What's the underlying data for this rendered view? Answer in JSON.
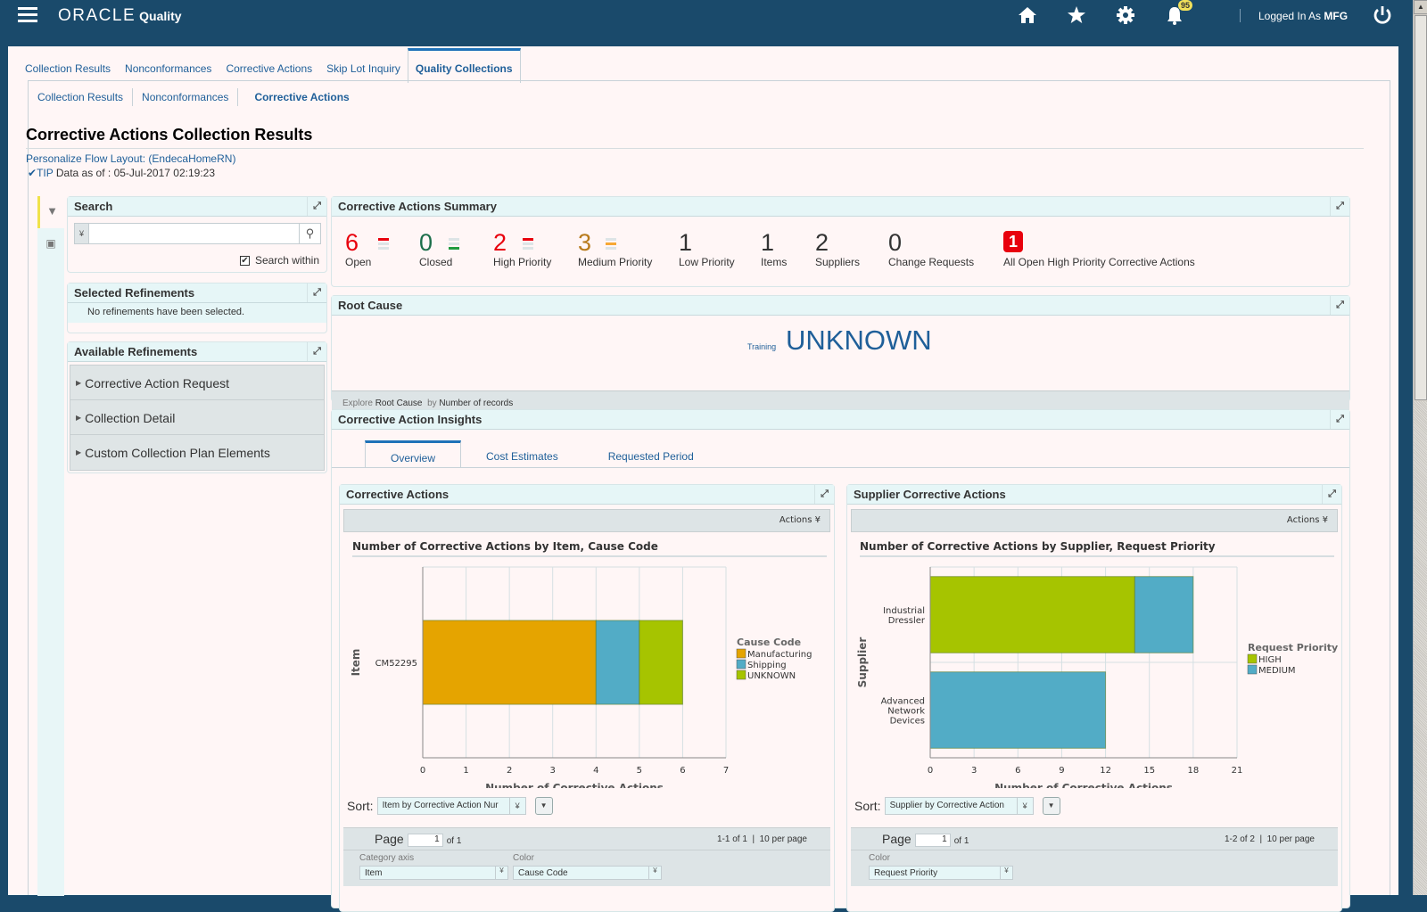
{
  "header": {
    "logo": "ORACLE",
    "app_name": "Quality",
    "notification_count": "95",
    "logged_in_prefix": "Logged In As",
    "user": "MFG"
  },
  "tabs": [
    {
      "label": "Collection Results"
    },
    {
      "label": "Nonconformances"
    },
    {
      "label": "Corrective Actions"
    },
    {
      "label": "Skip Lot Inquiry"
    },
    {
      "label": "Quality Collections",
      "active": true
    }
  ],
  "subtabs": [
    {
      "label": "Collection Results"
    },
    {
      "label": "Nonconformances"
    },
    {
      "label": "Corrective Actions",
      "active": true
    }
  ],
  "page": {
    "title": "Corrective Actions Collection Results",
    "personalize_link": "Personalize Flow Layout: (EndecaHomeRN)",
    "tip_label": "TIP",
    "data_as_of_label": "Data as of :",
    "data_as_of": "05-Jul-2017 02:19:23"
  },
  "search": {
    "title": "Search",
    "value": "",
    "search_within_label": "Search within",
    "search_within_checked": true
  },
  "selected_refinements": {
    "title": "Selected Refinements",
    "empty_text": "No refinements have been selected."
  },
  "available_refinements": {
    "title": "Available Refinements",
    "items": [
      {
        "label": "Corrective Action Request"
      },
      {
        "label": "Collection Detail"
      },
      {
        "label": "Custom Collection Plan Elements"
      }
    ]
  },
  "summary": {
    "title": "Corrective Actions Summary",
    "metrics": [
      {
        "value": "6",
        "label": "Open",
        "color": "#e8000d",
        "indicator": "red"
      },
      {
        "value": "0",
        "label": "Closed",
        "color": "#1b6e4a",
        "indicator": "green"
      },
      {
        "value": "2",
        "label": "High Priority",
        "color": "#e8000d",
        "indicator": "red"
      },
      {
        "value": "3",
        "label": "Medium Priority",
        "color": "#b87b1c",
        "indicator": "orange"
      },
      {
        "value": "1",
        "label": "Low Priority",
        "color": "#333333"
      },
      {
        "value": "1",
        "label": "Items",
        "color": "#333333"
      },
      {
        "value": "2",
        "label": "Suppliers",
        "color": "#333333"
      },
      {
        "value": "0",
        "label": "Change Requests",
        "color": "#333333"
      }
    ],
    "alert": {
      "value": "1",
      "label": "All Open High Priority Corrective Actions"
    }
  },
  "root_cause": {
    "title": "Root Cause",
    "tags": [
      {
        "label": "Training",
        "weight": "small"
      },
      {
        "label": "UNKNOWN",
        "weight": "large"
      }
    ],
    "explore_label": "Explore",
    "explore_attr": "Root Cause",
    "by_label": "by",
    "by_metric": "Number of records"
  },
  "insights": {
    "title": "Corrective Action Insights",
    "tabs": [
      {
        "label": "Overview",
        "active": true
      },
      {
        "label": "Cost Estimates"
      },
      {
        "label": "Requested Period"
      }
    ]
  },
  "panels": {
    "left": {
      "title": "Corrective Actions",
      "actions_label": "Actions",
      "sort_label": "Sort:",
      "sort_value": "Item by Corrective Action Nur",
      "page_label": "Page",
      "page_value": "1",
      "page_of": "of 1",
      "range": "1-1 of 1",
      "per_page": "10 per page",
      "category_axis_label": "Category axis",
      "category_axis_value": "Item",
      "color_label": "Color",
      "color_value": "Cause Code"
    },
    "right": {
      "title": "Supplier Corrective Actions",
      "actions_label": "Actions",
      "sort_label": "Sort:",
      "sort_value": "Supplier by Corrective Action",
      "page_label": "Page",
      "page_value": "1",
      "page_of": "of 1",
      "range": "1-2 of 2",
      "per_page": "10 per page",
      "color_label": "Color",
      "color_value": "Request Priority"
    }
  },
  "chart_data": [
    {
      "type": "bar",
      "orientation": "horizontal",
      "stacked": true,
      "title": "Number of Corrective Actions by Item, Cause Code",
      "xlabel": "Number of Corrective Actions",
      "ylabel": "Item",
      "categories": [
        "CM52295"
      ],
      "series": [
        {
          "name": "Manufacturing",
          "values": [
            4
          ],
          "color": "#e5a400"
        },
        {
          "name": "Shipping",
          "values": [
            1
          ],
          "color": "#52acc6"
        },
        {
          "name": "UNKNOWN",
          "values": [
            1
          ],
          "color": "#a6c400"
        }
      ],
      "xlim": [
        0,
        7
      ],
      "xticks": [
        0,
        1,
        2,
        3,
        4,
        5,
        6,
        7
      ],
      "legend_title": "Cause Code",
      "legend": "right",
      "grid": true
    },
    {
      "type": "bar",
      "orientation": "horizontal",
      "stacked": true,
      "title": "Number of Corrective Actions by Supplier, Request Priority",
      "xlabel": "Number of Corrective Actions",
      "ylabel": "Supplier",
      "categories": [
        "Industrial Dressler",
        "Advanced Network Devices"
      ],
      "series": [
        {
          "name": "HIGH",
          "values": [
            14,
            0
          ],
          "color": "#a6c400"
        },
        {
          "name": "MEDIUM",
          "values": [
            4,
            12
          ],
          "color": "#52acc6"
        }
      ],
      "xlim": [
        0,
        21
      ],
      "xticks": [
        0,
        3,
        6,
        9,
        12,
        15,
        18,
        21
      ],
      "legend_title": "Request Priority",
      "legend": "right",
      "grid": true
    }
  ]
}
